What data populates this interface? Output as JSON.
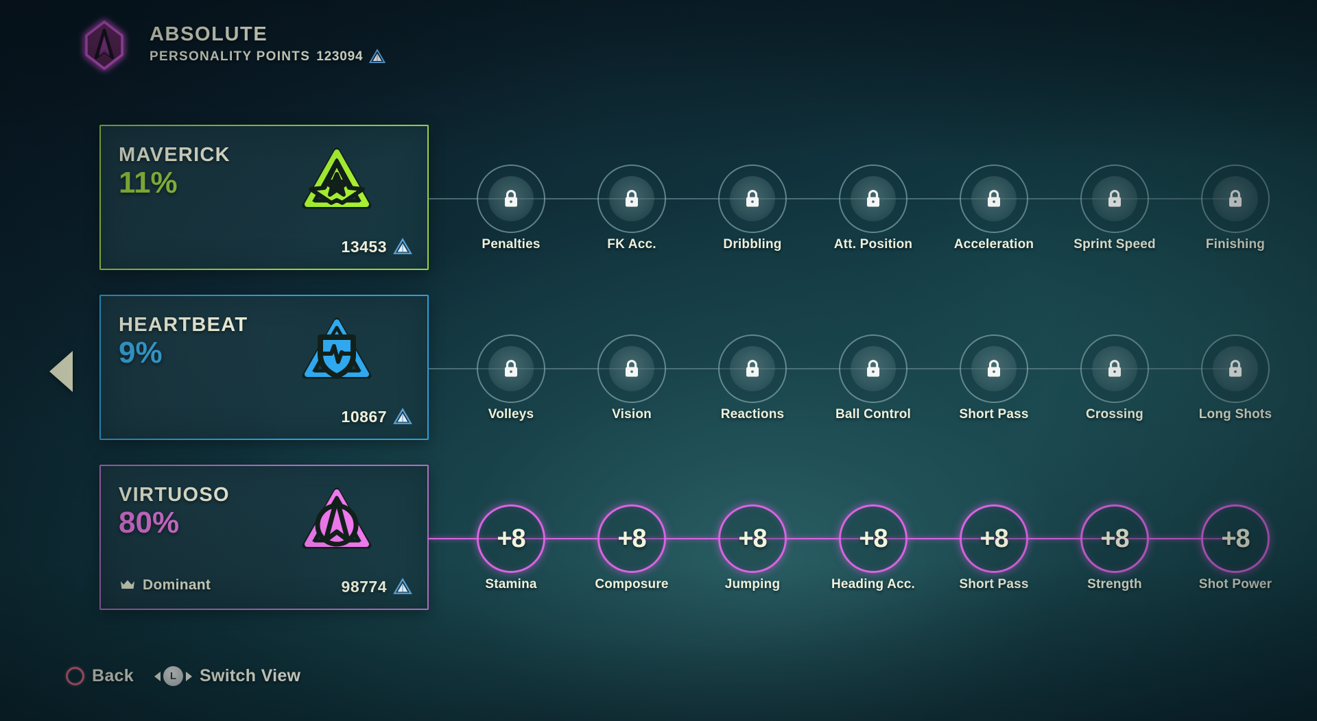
{
  "header": {
    "badge_icon": "absolute-playstyle-diamond-icon",
    "title": "ABSOLUTE",
    "points_label": "PERSONALITY POINTS",
    "points_value": "123094",
    "points_icon": "personality-points-triangle-icon"
  },
  "nav": {
    "left_arrow_icon": "left-arrow-icon"
  },
  "colors": {
    "maverick": "#9ad13f",
    "heartbeat": "#3aa9e0",
    "virtuoso": "#e878e0",
    "active_node": "#d964e0",
    "locked_node": "#a0c4c8",
    "text_cream": "#f2f4dd",
    "background": "#11323c"
  },
  "archetypes": [
    {
      "name": "MAVERICK",
      "percent": "11%",
      "points": "13453",
      "points_icon": "personality-points-triangle-icon",
      "emblem_icon": "maverick-star-emblem-icon",
      "accent": "#9ad13f",
      "dominant": null,
      "dominant_icon": null
    },
    {
      "name": "HEARTBEAT",
      "percent": "9%",
      "points": "10867",
      "points_icon": "personality-points-triangle-icon",
      "emblem_icon": "heartbeat-shield-emblem-icon",
      "accent": "#3aa9e0",
      "dominant": null,
      "dominant_icon": null
    },
    {
      "name": "VIRTUOSO",
      "percent": "80%",
      "points": "98774",
      "points_icon": "personality-points-triangle-icon",
      "emblem_icon": "virtuoso-triangle-emblem-icon",
      "accent": "#e878e0",
      "dominant": "Dominant",
      "dominant_icon": "crown-icon"
    }
  ],
  "rows": [
    {
      "state": "locked",
      "nodes": [
        {
          "label": "Penalties",
          "value": null,
          "icon": "lock-icon"
        },
        {
          "label": "FK Acc.",
          "value": null,
          "icon": "lock-icon"
        },
        {
          "label": "Dribbling",
          "value": null,
          "icon": "lock-icon"
        },
        {
          "label": "Att. Position",
          "value": null,
          "icon": "lock-icon"
        },
        {
          "label": "Acceleration",
          "value": null,
          "icon": "lock-icon"
        },
        {
          "label": "Sprint Speed",
          "value": null,
          "icon": "lock-icon"
        },
        {
          "label": "Finishing",
          "value": null,
          "icon": "lock-icon"
        }
      ]
    },
    {
      "state": "locked",
      "nodes": [
        {
          "label": "Volleys",
          "value": null,
          "icon": "lock-icon"
        },
        {
          "label": "Vision",
          "value": null,
          "icon": "lock-icon"
        },
        {
          "label": "Reactions",
          "value": null,
          "icon": "lock-icon"
        },
        {
          "label": "Ball Control",
          "value": null,
          "icon": "lock-icon"
        },
        {
          "label": "Short Pass",
          "value": null,
          "icon": "lock-icon"
        },
        {
          "label": "Crossing",
          "value": null,
          "icon": "lock-icon"
        },
        {
          "label": "Long Shots",
          "value": null,
          "icon": "lock-icon"
        }
      ]
    },
    {
      "state": "active",
      "nodes": [
        {
          "label": "Stamina",
          "value": "+8",
          "icon": null
        },
        {
          "label": "Composure",
          "value": "+8",
          "icon": null
        },
        {
          "label": "Jumping",
          "value": "+8",
          "icon": null
        },
        {
          "label": "Heading Acc.",
          "value": "+8",
          "icon": null
        },
        {
          "label": "Short Pass",
          "value": "+8",
          "icon": null
        },
        {
          "label": "Strength",
          "value": "+8",
          "icon": null
        },
        {
          "label": "Shot Power",
          "value": "+8",
          "icon": null
        }
      ]
    }
  ],
  "footer": {
    "back_label": "Back",
    "back_icon": "circle-button-icon",
    "switch_label": "Switch View",
    "switch_key": "L",
    "switch_left_icon": "triangle-left-icon",
    "switch_right_icon": "triangle-right-icon"
  }
}
